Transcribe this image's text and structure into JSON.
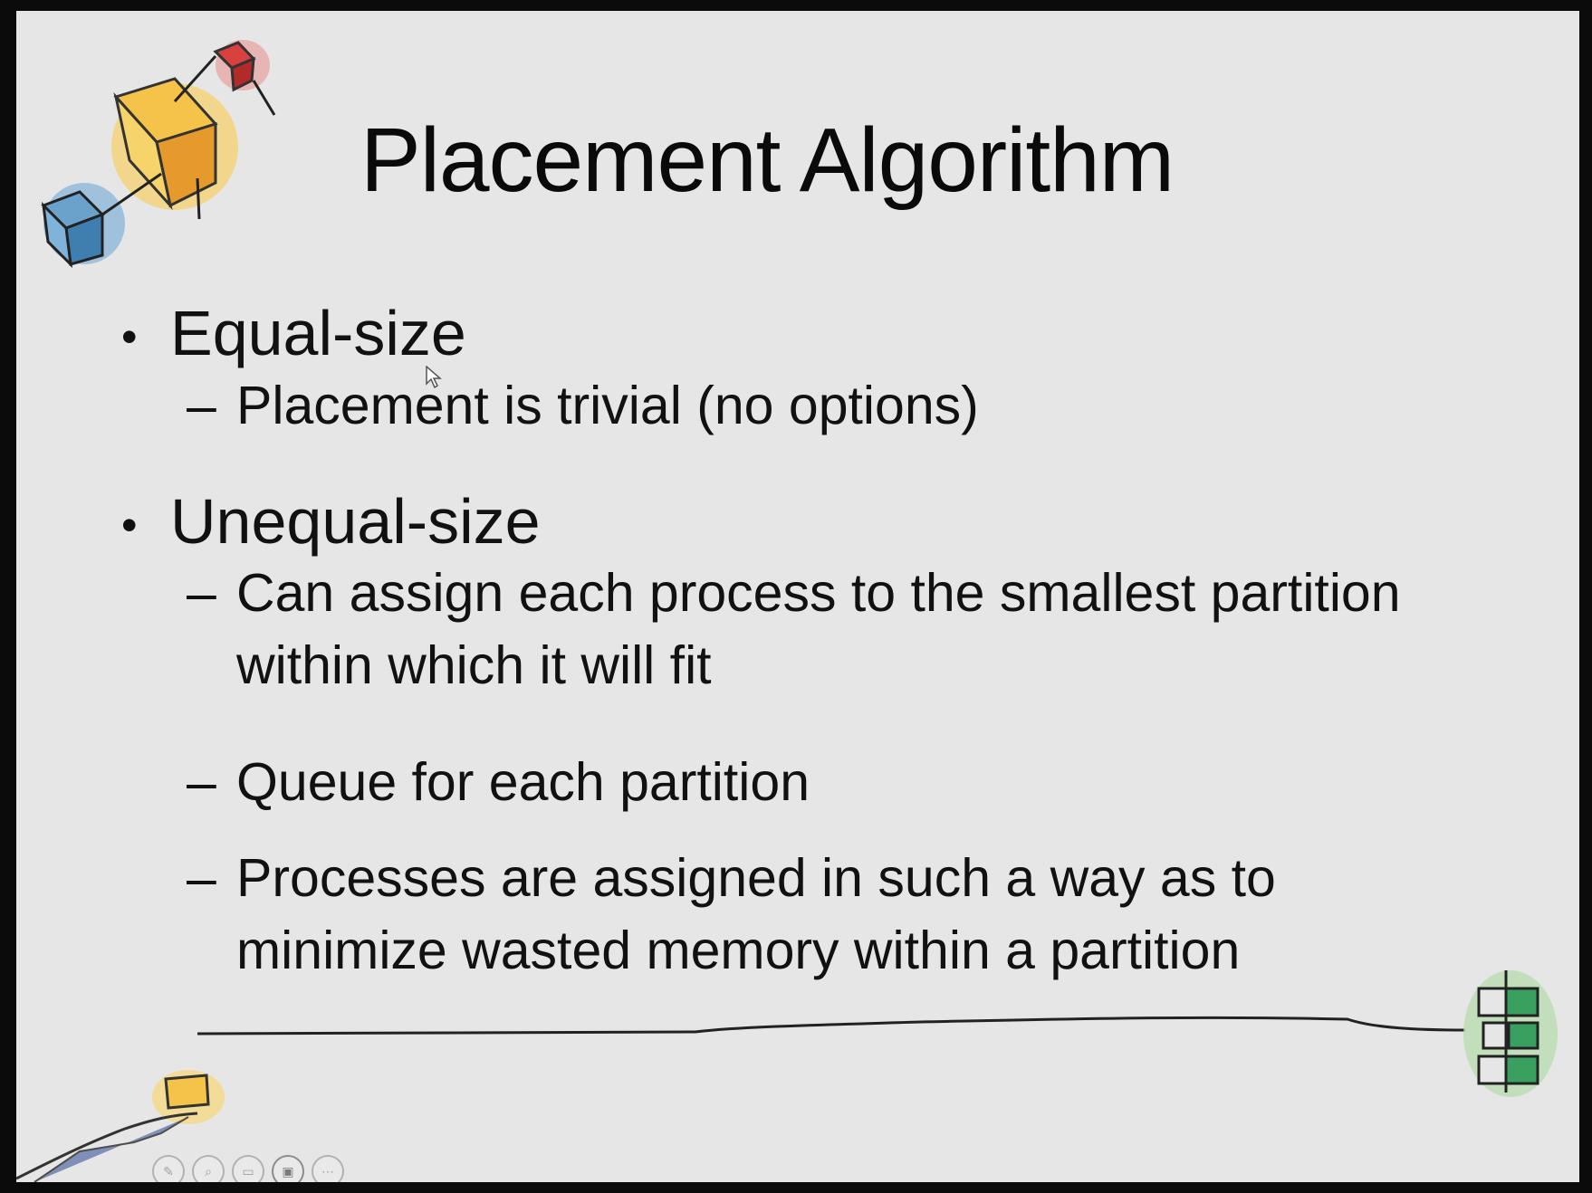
{
  "slide": {
    "title": "Placement Algorithm",
    "bullets": [
      {
        "text": "Equal-size",
        "subitems": [
          "Placement is trivial (no options)"
        ]
      },
      {
        "text": "Unequal-size",
        "subitems": [
          "Can assign each process to the smallest partition within which it will fit",
          "Queue for each partition",
          "Processes are assigned in such a way as to minimize wasted memory within a partition"
        ]
      }
    ],
    "bullet_glyph": "•",
    "dash_glyph": "–"
  },
  "toolbar": {
    "icons": [
      "pen-icon",
      "zoom-icon",
      "subtitles-icon",
      "camera-icon",
      "more-icon"
    ]
  },
  "colors": {
    "slide_bg": "#e6e6e6",
    "frame_bg": "#0b0b0b",
    "text": "#111111"
  }
}
